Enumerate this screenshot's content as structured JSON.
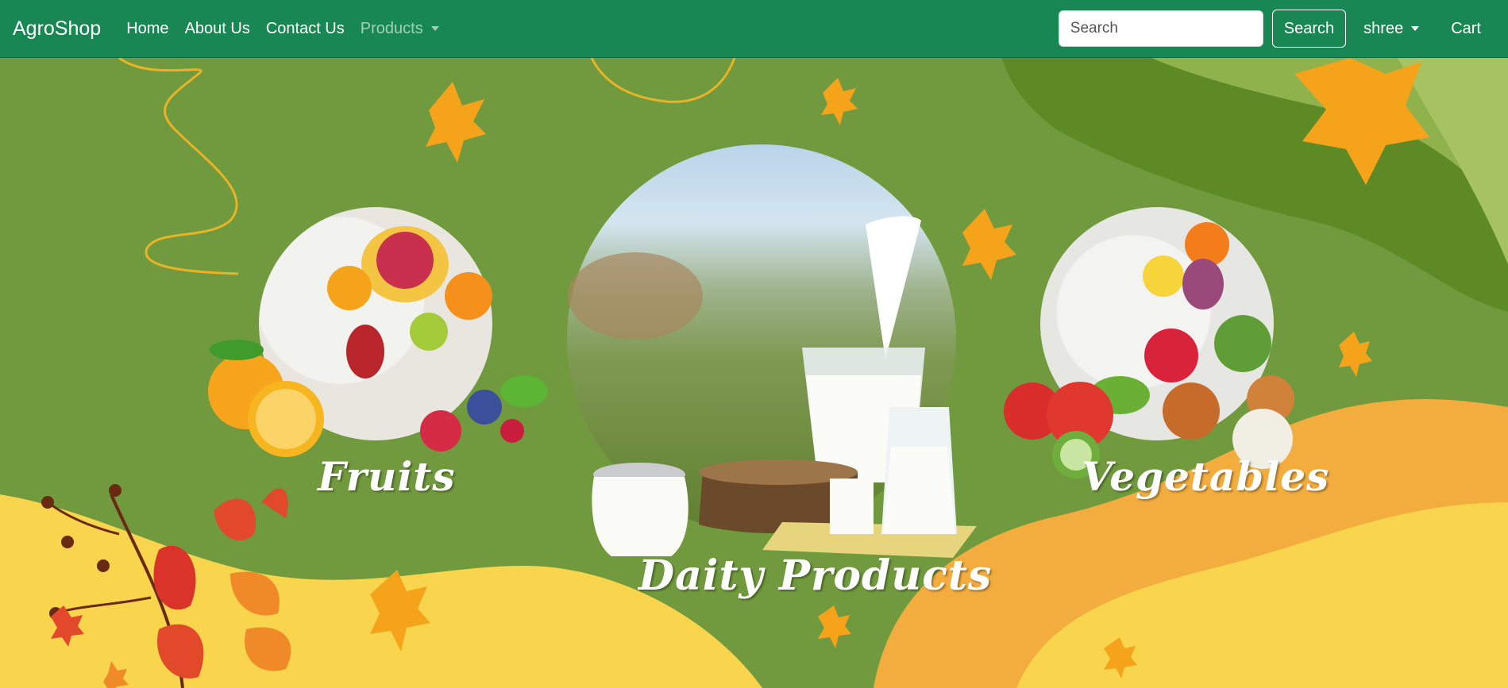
{
  "navbar": {
    "brand": "AgroShop",
    "links": [
      "Home",
      "About Us",
      "Contact Us"
    ],
    "products_label": "Products",
    "search": {
      "placeholder": "Search",
      "button_label": "Search"
    },
    "user_label": "shree",
    "cart_label": "Cart"
  },
  "hero": {
    "categories": {
      "fruits": "Fruits",
      "dairy": "Daity Products",
      "vegetables": "Vegetables"
    }
  },
  "colors": {
    "navbar": "#198754",
    "hero_green": "#719a3e",
    "dark_green": "#5e8a26",
    "light_green": "#8fb24d",
    "yellow": "#f9d54d",
    "orange": "#f2ad3e",
    "leaf_orange": "#f6a31c"
  }
}
